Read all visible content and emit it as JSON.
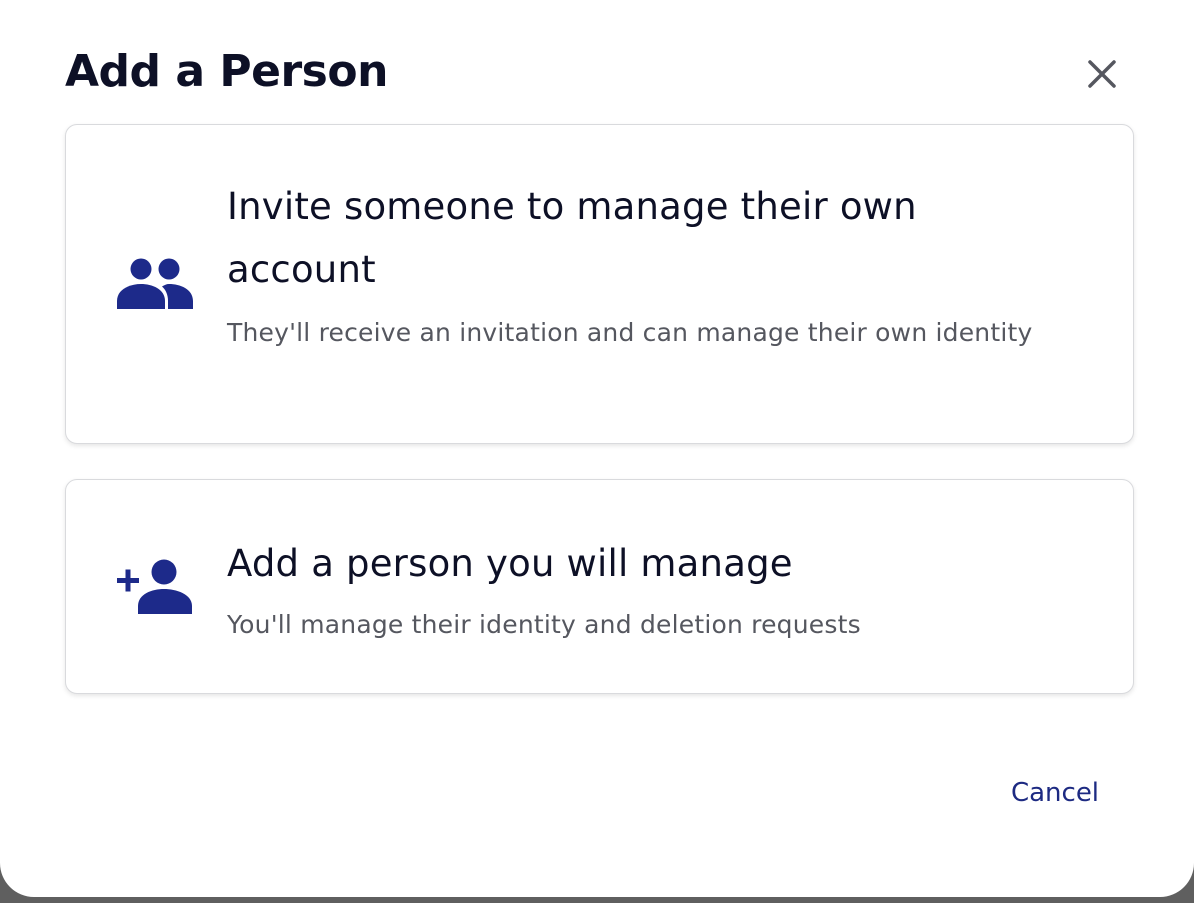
{
  "dialog": {
    "title": "Add a Person",
    "close_icon": "close-icon"
  },
  "options": [
    {
      "icon": "people-icon",
      "title": "Invite someone to manage their own account",
      "description": "They'll receive an invitation and can manage their own identity"
    },
    {
      "icon": "add-person-icon",
      "title": "Add a person you will manage",
      "description": "You'll manage their identity and deletion requests"
    }
  ],
  "footer": {
    "cancel_label": "Cancel"
  },
  "colors": {
    "icon_accent": "#1d2a8a",
    "title_text": "#0d1026",
    "description_text": "#55575f",
    "cancel_text": "#1d2a82",
    "card_border": "#d9dadd",
    "close_icon": "#55575f"
  }
}
